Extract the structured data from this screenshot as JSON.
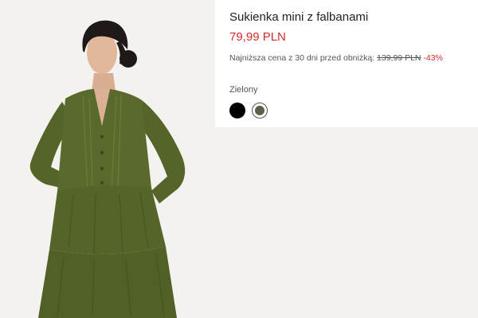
{
  "product": {
    "title": "Sukienka mini z falbanami",
    "price": "79,99 PLN",
    "lowest_price_label": "Najniższa cena z 30 dni przed obniżką:",
    "old_price": "139,99 PLN",
    "discount": "-43%"
  },
  "color": {
    "selected_label": "Zielony",
    "swatches": [
      {
        "name": "black",
        "hex": "#000000"
      },
      {
        "name": "green",
        "hex": "#5b6048"
      }
    ]
  },
  "colors": {
    "price_red": "#d52b2b",
    "dress_green": "#5a6a2c",
    "background": "#f3f2ef"
  }
}
